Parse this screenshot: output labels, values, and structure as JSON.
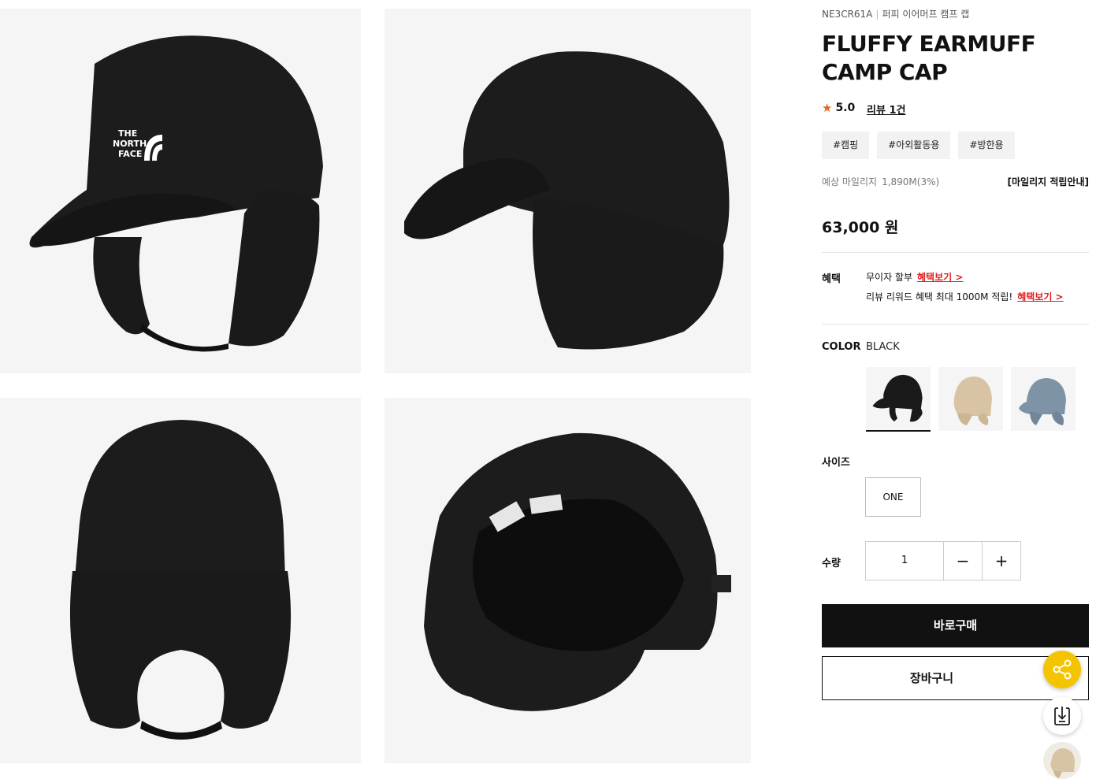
{
  "product": {
    "code": "NE3CR61A",
    "korean_name": "퍼피 이어머프 캠프 캡",
    "title": "FLUFFY EARMUFF CAMP CAP",
    "rating": "5.0",
    "review_link": "리뷰 1건",
    "tags": [
      "#캠핑",
      "#아외활동용",
      "#방한용"
    ],
    "mileage_label": "예상 마일리지",
    "mileage_value": "1,890M(3%)",
    "mileage_guide": "[마일리지 적립안내]",
    "price": "63,000 원"
  },
  "benefits": {
    "label": "혜택",
    "line1_text": "무이자 할부",
    "line1_link": "혜택보기 >",
    "line2_text": "리뷰 리워드 혜택 최대 1000M 적립!",
    "line2_link": "혜택보기 >"
  },
  "color": {
    "label": "COLOR",
    "selected": "BLACK",
    "swatch_colors": [
      "#1a1a1a",
      "#d8c3a5",
      "#7f93a6"
    ]
  },
  "size": {
    "label": "사이즈",
    "options": [
      "ONE"
    ]
  },
  "quantity": {
    "label": "수량",
    "value": "1",
    "minus": "−",
    "plus": "+"
  },
  "actions": {
    "buy_now": "바로구매",
    "cart": "장바구니"
  },
  "brand_logo_text": [
    "THE",
    "NORTH",
    "FACE"
  ]
}
